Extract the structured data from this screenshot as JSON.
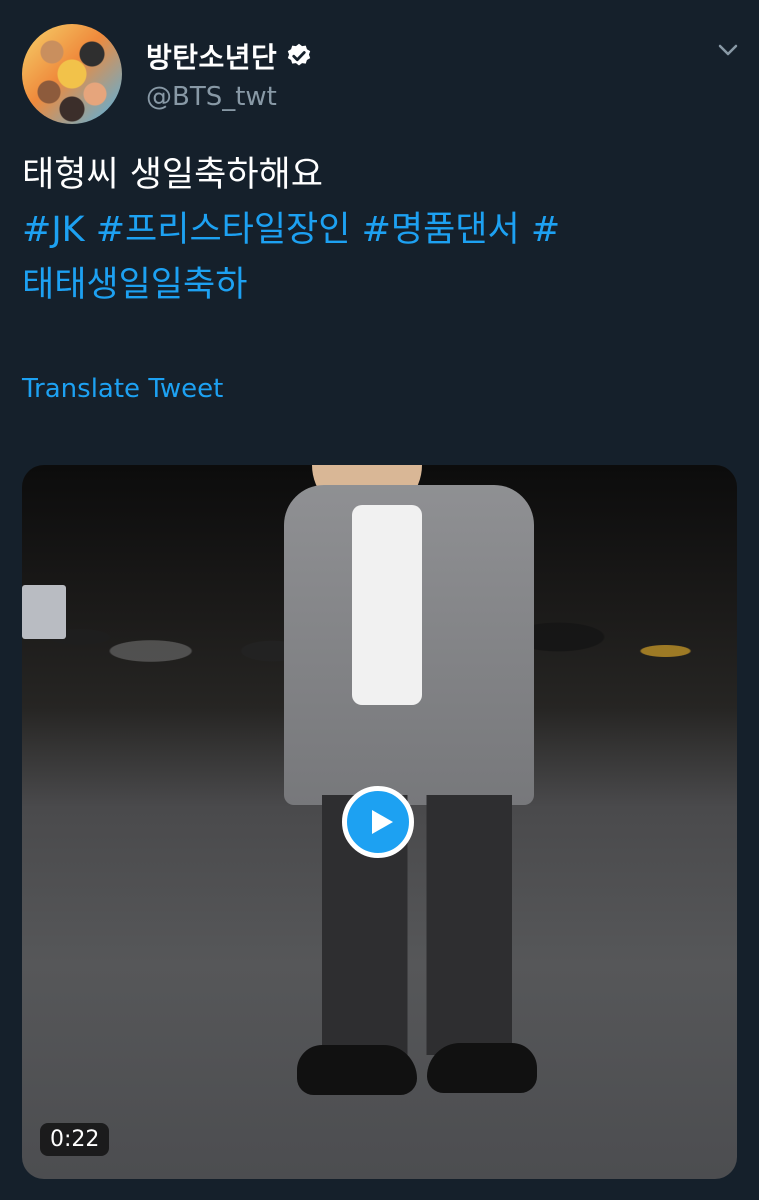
{
  "tweet": {
    "display_name": "방탄소년단",
    "handle": "@BTS_twt",
    "text_line1": "태형씨 생일축하해요",
    "hashtags_line2": "#JK #프리스타일장인 #명품댄서 #",
    "hashtags_line3": "태태생일일축하",
    "translate_label": "Translate Tweet"
  },
  "media": {
    "duration": "0:22"
  },
  "icons": {
    "verified": "verified-badge-icon",
    "menu": "chevron-down-icon",
    "play": "play-icon"
  },
  "colors": {
    "background": "#15202b",
    "accent": "#1da1f2",
    "secondary_text": "#8899a6"
  }
}
